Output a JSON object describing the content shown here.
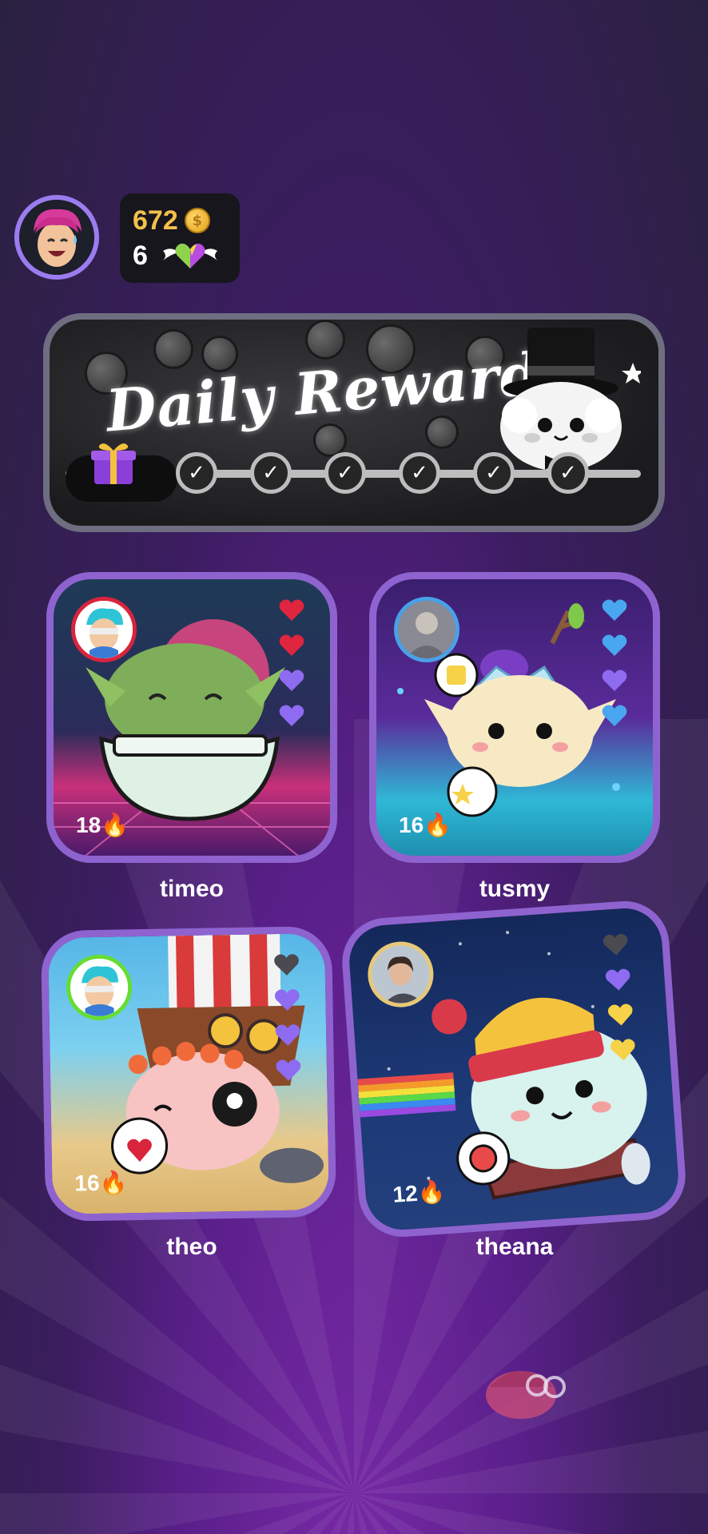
{
  "profile": {
    "coins": "672",
    "hearts": "6",
    "avatar_icon": "user-avatar",
    "coin_icon": "coin-icon",
    "heart_icon": "winged-heart-icon"
  },
  "daily_reward": {
    "title": "Daily Reward",
    "days_completed": 6,
    "check_glyph": "✓"
  },
  "friends": [
    {
      "name": "timeo",
      "streak": "18🔥",
      "hearts": [
        "red",
        "red",
        "purple",
        "purple"
      ],
      "avatar_border": "#d9243d",
      "bg": "synthwave"
    },
    {
      "name": "tusmy",
      "streak": "16🔥",
      "hearts": [
        "blue",
        "blue",
        "purple",
        "blue"
      ],
      "avatar_border": "#4aa0e8",
      "bg": "forest"
    },
    {
      "name": "theo",
      "streak": "16🔥",
      "hearts": [
        "gray",
        "purple",
        "purple",
        "purple"
      ],
      "avatar_border": "#66dd33",
      "bg": "beach"
    },
    {
      "name": "theana",
      "streak": "12🔥",
      "hearts": [
        "gray",
        "purple",
        "yellow",
        "yellow"
      ],
      "avatar_border": "#e6c878",
      "bg": "space"
    }
  ],
  "colors": {
    "card_border": "#8e63cf",
    "accent_gold": "#f3c04b",
    "red": "#e0253f",
    "purple": "#8e6bf0",
    "blue": "#49a6f0",
    "yellow": "#f5d247"
  }
}
